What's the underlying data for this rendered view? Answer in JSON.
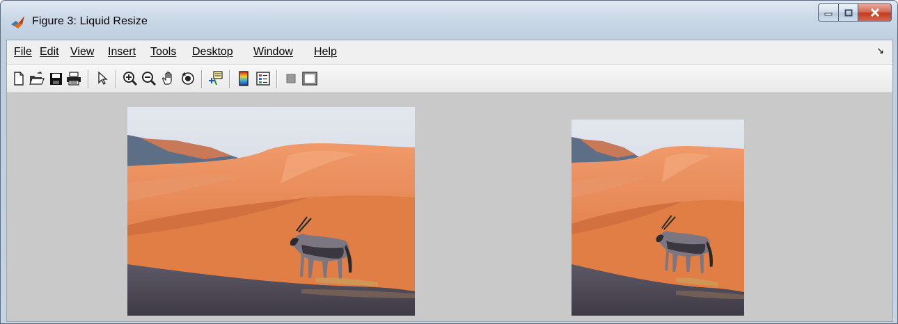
{
  "window": {
    "title": "Figure 3: Liquid Resize"
  },
  "menu": {
    "items": [
      {
        "label": "File",
        "name": "menu-file"
      },
      {
        "label": "Edit",
        "name": "menu-edit"
      },
      {
        "label": "View",
        "name": "menu-view"
      },
      {
        "label": "Insert",
        "name": "menu-insert"
      },
      {
        "label": "Tools",
        "name": "menu-tools"
      },
      {
        "label": "Desktop",
        "name": "menu-desktop"
      },
      {
        "label": "Window",
        "name": "menu-window"
      },
      {
        "label": "Help",
        "name": "menu-help"
      }
    ],
    "dock_glyph": "↘"
  },
  "toolbar": {
    "buttons": [
      "new-figure",
      "open-file",
      "save-figure",
      "print-figure",
      "edit-plot",
      "zoom-in",
      "zoom-out",
      "pan",
      "rotate-3d",
      "data-cursor",
      "insert-colorbar",
      "insert-legend",
      "hide-plot-tools",
      "show-plot-tools"
    ]
  },
  "figure": {
    "background": "#c9c9c9",
    "images": [
      {
        "name": "original-image",
        "description_role": "original desert oryx photo"
      },
      {
        "name": "resized-image",
        "description_role": "liquid-resized desert oryx photo"
      }
    ]
  },
  "colors": {
    "sky_top": "#dfe3ea",
    "dune_orange": "#e8874f",
    "dune_shadow": "#c9673a",
    "ground": "#4e4a55",
    "oryx": "#7d7880"
  }
}
